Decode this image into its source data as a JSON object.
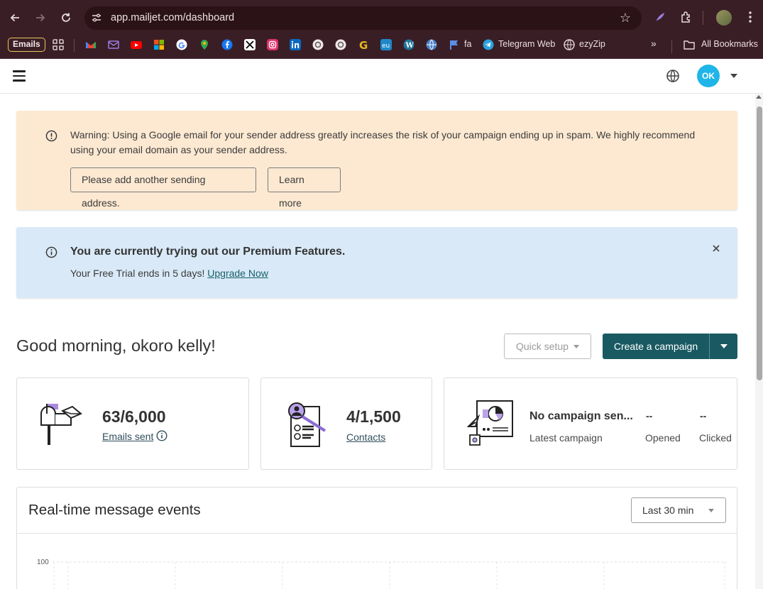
{
  "browser": {
    "url": "app.mailjet.com/dashboard",
    "bookmarks": {
      "emails_label": "Emails",
      "fa_label": "fa",
      "telegram_label": "Telegram Web",
      "ezyzip_label": "ezyZip",
      "all_bookmarks_label": "All Bookmarks"
    }
  },
  "header": {
    "avatar_initials": "OK"
  },
  "warning": {
    "text": "Warning: Using a Google email for your sender address greatly increases the risk of your campaign ending up in spam. We highly recommend using your email domain as your sender address.",
    "add_address_label": "Please add another sending address.",
    "learn_more_label": "Learn more"
  },
  "trial": {
    "title": "You are currently trying out our Premium Features.",
    "subtitle": "Your Free Trial ends in 5 days!",
    "upgrade_label": "Upgrade Now"
  },
  "greeting": "Good morning, okoro kelly!",
  "actions": {
    "quick_setup_label": "Quick setup",
    "create_campaign_label": "Create a campaign"
  },
  "stats": {
    "emails": {
      "value": "63/6,000",
      "label": "Emails sent"
    },
    "contacts": {
      "value": "4/1,500",
      "label": "Contacts"
    },
    "campaign": {
      "name": "No campaign sen...",
      "label": "Latest campaign",
      "opened_value": "--",
      "opened_label": "Opened",
      "clicked_value": "--",
      "clicked_label": "Clicked"
    }
  },
  "realtime": {
    "title": "Real-time message events",
    "range_label": "Last 30 min",
    "y_max_label": "100"
  },
  "colors": {
    "chrome": "#3a1e26",
    "warning_bg": "#fde9d2",
    "info_bg": "#d9e9f7",
    "primary": "#195962",
    "avatar": "#1fb5e8"
  }
}
